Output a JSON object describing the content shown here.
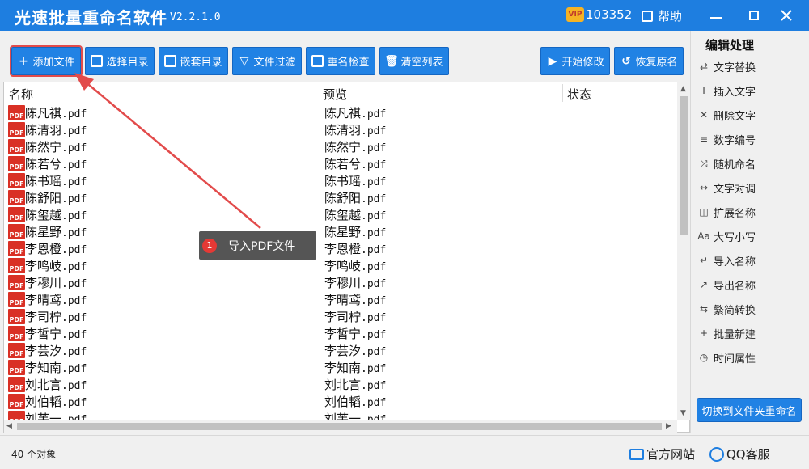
{
  "app": {
    "title": "光速批量重命名软件",
    "version": "V2.2.1.0",
    "vip_badge": "VIP",
    "vip_number": "103352",
    "help_label": "帮助",
    "accent": "#1e7ee0"
  },
  "toolbar": {
    "buttons": [
      {
        "label": "添加文件",
        "icon": "plus-icon"
      },
      {
        "label": "选择目录",
        "icon": "folder-add-icon"
      },
      {
        "label": "嵌套目录",
        "icon": "folder-open-icon"
      },
      {
        "label": "文件过滤",
        "icon": "filter-icon"
      },
      {
        "label": "重名检查",
        "icon": "duplicate-check-icon"
      },
      {
        "label": "清空列表",
        "icon": "trash-icon"
      },
      {
        "label": "开始修改",
        "icon": "play-icon"
      },
      {
        "label": "恢复原名",
        "icon": "undo-icon"
      }
    ]
  },
  "list": {
    "columns": {
      "name": "名称",
      "preview": "预览",
      "status": "状态"
    },
    "rows": [
      {
        "base": "陈凡祺",
        "ext": ".pdf"
      },
      {
        "base": "陈清羽",
        "ext": ".pdf"
      },
      {
        "base": "陈然宁",
        "ext": ".pdf"
      },
      {
        "base": "陈若兮",
        "ext": ".pdf"
      },
      {
        "base": "陈书瑶",
        "ext": ".pdf"
      },
      {
        "base": "陈舒阳",
        "ext": ".pdf"
      },
      {
        "base": "陈玺越",
        "ext": ".pdf"
      },
      {
        "base": "陈星野",
        "ext": ".pdf"
      },
      {
        "base": "李恩橙",
        "ext": ".pdf"
      },
      {
        "base": "李鸣岐",
        "ext": ".pdf"
      },
      {
        "base": "李穆川",
        "ext": ".pdf"
      },
      {
        "base": "李晴鸢",
        "ext": ".pdf"
      },
      {
        "base": "李司柠",
        "ext": ".pdf"
      },
      {
        "base": "李皙宁",
        "ext": ".pdf"
      },
      {
        "base": "李芸汐",
        "ext": ".pdf"
      },
      {
        "base": "李知南",
        "ext": ".pdf"
      },
      {
        "base": "刘北言",
        "ext": ".pdf"
      },
      {
        "base": "刘伯韬",
        "ext": ".pdf"
      },
      {
        "base": "刘芙一",
        "ext": ".pdf"
      }
    ],
    "file_icon_label": "PDF"
  },
  "side": {
    "title": "编辑处理",
    "items": [
      {
        "label": "文字替换",
        "icon": "replace-icon"
      },
      {
        "label": "插入文字",
        "icon": "insert-text-icon"
      },
      {
        "label": "删除文字",
        "icon": "delete-text-icon"
      },
      {
        "label": "数字编号",
        "icon": "numbering-icon"
      },
      {
        "label": "随机命名",
        "icon": "shuffle-icon"
      },
      {
        "label": "文字对调",
        "icon": "swap-icon"
      },
      {
        "label": "扩展名称",
        "icon": "extension-icon"
      },
      {
        "label": "大写小写",
        "icon": "case-icon"
      },
      {
        "label": "导入名称",
        "icon": "import-icon"
      },
      {
        "label": "导出名称",
        "icon": "export-icon"
      },
      {
        "label": "繁简转换",
        "icon": "convert-icon"
      },
      {
        "label": "批量新建",
        "icon": "batch-new-icon"
      },
      {
        "label": "时间属性",
        "icon": "clock-icon"
      }
    ],
    "switch_label": "切换到文件夹重命名"
  },
  "status": {
    "count": "40 个对象",
    "website": "官方网站",
    "qq": "QQ客服"
  },
  "callout": {
    "number": "1",
    "text": "导入PDF文件",
    "arrow_color": "#e24b4b"
  }
}
